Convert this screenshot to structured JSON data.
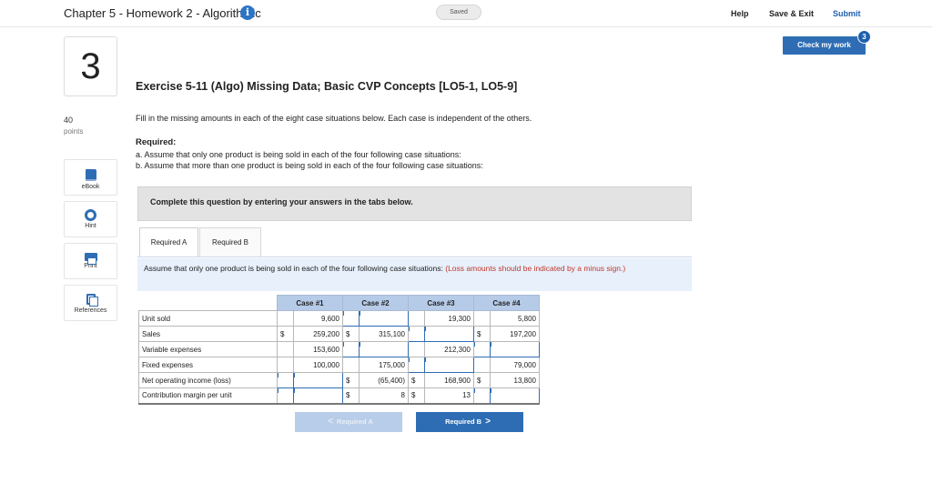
{
  "header": {
    "title": "Chapter 5 - Homework 2 - Algorithmic",
    "info_icon": "info-icon",
    "saved_status": "Saved",
    "help_label": "Help",
    "save_exit_label": "Save & Exit",
    "submit_label": "Submit",
    "check_work_label": "Check my work",
    "check_work_count": "3"
  },
  "question": {
    "number": "3",
    "points_value": "40",
    "points_label": "points",
    "title": "Exercise 5-11 (Algo) Missing Data; Basic CVP Concepts [LO5-1, LO5-9]",
    "instructions": "Fill in the missing amounts in each of the eight case situations below. Each case is independent of the others.",
    "required_heading": "Required:",
    "required_a": "a. Assume that only one product is being sold in each of the four following case situations:",
    "required_b": "b. Assume that more than one product is being sold in each of the four following case situations:"
  },
  "tools": [
    {
      "label": "eBook",
      "icon": "book-icon"
    },
    {
      "label": "Hint",
      "icon": "lifebuoy-icon"
    },
    {
      "label": "Print",
      "icon": "printer-icon"
    },
    {
      "label": "References",
      "icon": "documents-icon"
    }
  ],
  "banner": {
    "text": "Complete this question by entering your answers in the tabs below."
  },
  "tabs": [
    {
      "label": "Required A",
      "active": true
    },
    {
      "label": "Required B",
      "active": false
    }
  ],
  "panel": {
    "text": "Assume that only one product is being sold in each of the four following case situations: ",
    "note": "(Loss amounts should be indicated by a minus sign.)"
  },
  "table": {
    "columns": [
      "Case #1",
      "Case #2",
      "Case #3",
      "Case #4"
    ],
    "rows": [
      {
        "label": "Unit sold",
        "cells": [
          [
            "",
            "9,600"
          ],
          [
            "",
            ""
          ],
          [
            "",
            "19,300"
          ],
          [
            "",
            "5,800"
          ]
        ]
      },
      {
        "label": "Sales",
        "cells": [
          [
            "$",
            "259,200"
          ],
          [
            "$",
            "315,100"
          ],
          [
            "",
            ""
          ],
          [
            "$",
            "197,200"
          ]
        ]
      },
      {
        "label": "Variable expenses",
        "cells": [
          [
            "",
            "153,600"
          ],
          [
            "",
            ""
          ],
          [
            "",
            "212,300"
          ],
          [
            "",
            ""
          ]
        ]
      },
      {
        "label": "Fixed expenses",
        "cells": [
          [
            "",
            "100,000"
          ],
          [
            "",
            "175,000"
          ],
          [
            "",
            ""
          ],
          [
            "",
            "79,000"
          ]
        ]
      },
      {
        "label": "Net operating income (loss)",
        "cells": [
          [
            "",
            ""
          ],
          [
            "$",
            "(65,400)"
          ],
          [
            "$",
            "168,900"
          ],
          [
            "$",
            "13,800"
          ]
        ]
      },
      {
        "label": "Contribution margin per unit",
        "cells": [
          [
            "",
            ""
          ],
          [
            "$",
            "8"
          ],
          [
            "$",
            "13"
          ],
          [
            "",
            ""
          ]
        ]
      }
    ],
    "input_cells": [
      [
        0,
        1
      ],
      [
        1,
        2
      ],
      [
        2,
        1
      ],
      [
        2,
        3
      ],
      [
        3,
        2
      ],
      [
        4,
        0
      ],
      [
        5,
        0
      ],
      [
        5,
        3
      ]
    ]
  },
  "nav": {
    "prev_label": "Required A",
    "next_label": "Required B",
    "prev_chevron": "<",
    "next_chevron": ">"
  }
}
